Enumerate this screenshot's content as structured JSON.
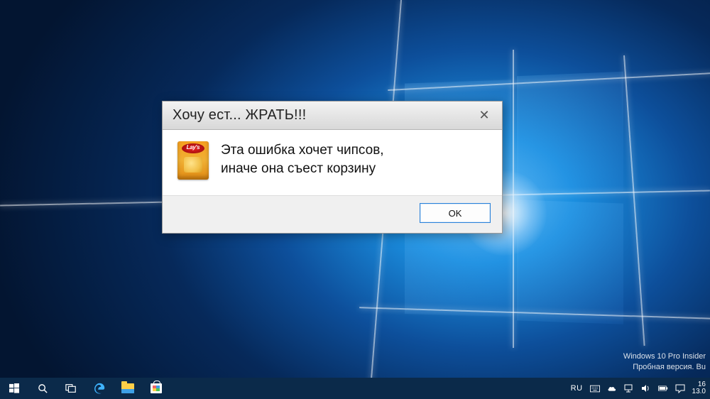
{
  "dialog": {
    "title": "Хочу ест... ЖРАТЬ!!!",
    "message_line1": "Эта ошибка хочет чипсов,",
    "message_line2": "иначе она съест корзину",
    "ok_label": "OK",
    "close_glyph": "✕",
    "icon_name": "lays-chips-bag"
  },
  "watermark": {
    "line1": "Windows 10 Pro Insider",
    "line2": "Пробная версия. Bu"
  },
  "taskbar": {
    "lang": "RU",
    "time": "16",
    "date": "13.0"
  }
}
